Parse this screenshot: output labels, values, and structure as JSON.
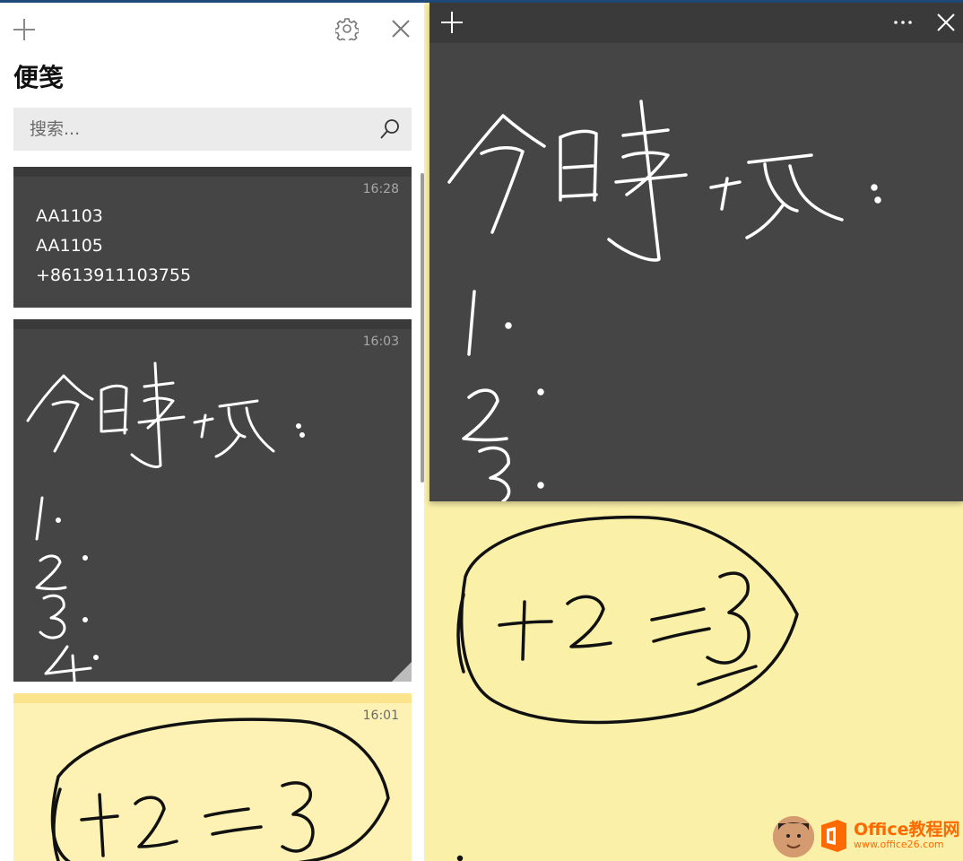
{
  "app": {
    "title": "便笺"
  },
  "toolbar": {
    "new_icon": "plus-icon",
    "settings_icon": "gear-icon",
    "close_icon": "close-icon"
  },
  "search": {
    "placeholder": "搜索...",
    "icon": "search-icon"
  },
  "notes": [
    {
      "time": "16:28",
      "color": "#454545",
      "lines": [
        "AA1103",
        "AA1105",
        "+8613911103755"
      ]
    },
    {
      "time": "16:03",
      "color": "#454545",
      "content": "handwritten ink"
    },
    {
      "time": "16:01",
      "color": "#fdf2b3",
      "content": "handwritten ink"
    }
  ],
  "open_note_dark": {
    "toolbar": {
      "new_icon": "plus-icon",
      "menu_icon": "more-icon",
      "close_icon": "close-icon"
    },
    "color": "#454545"
  },
  "open_note_yellow": {
    "color": "#fbf0a8"
  },
  "watermark": {
    "line1": "Office教程网",
    "line2": "www.office26.com",
    "accent": "#ff6a00"
  }
}
